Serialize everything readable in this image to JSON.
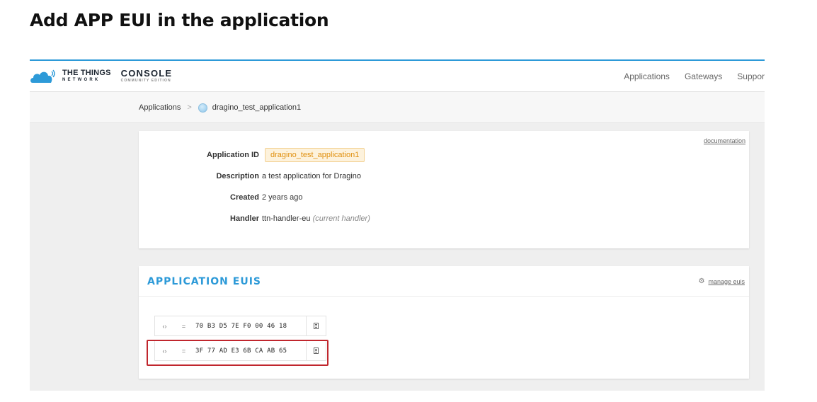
{
  "doc": {
    "title": "Add APP EUI in the application"
  },
  "navbar": {
    "logo_main": "THE THINGS",
    "logo_sub": "NETWORK",
    "console_main": "CONSOLE",
    "console_sub": "COMMUNITY EDITION",
    "links": [
      "Applications",
      "Gateways",
      "Suppor"
    ]
  },
  "breadcrumb": {
    "root": "Applications",
    "separator": ">",
    "current": "dragino_test_application1"
  },
  "info": {
    "documentation_link": "documentation",
    "rows": [
      {
        "label": "Application ID",
        "value": "dragino_test_application1"
      },
      {
        "label": "Description",
        "value": "a test application for Dragino"
      },
      {
        "label": "Created",
        "value": "2 years ago"
      },
      {
        "label": "Handler",
        "value": "ttn-handler-eu",
        "note": "(current handler)"
      }
    ]
  },
  "euis": {
    "title": "APPLICATION EUIS",
    "manage_label": "manage euis",
    "items": [
      {
        "value": "70 B3 D5 7E F0 00 46 18",
        "toggle_icon": "‹›",
        "format_icon": "="
      },
      {
        "value": "3F 77 AD E3 6B CA AB 65",
        "toggle_icon": "‹›",
        "format_icon": "="
      }
    ]
  },
  "colors": {
    "accent": "#2d9ad8",
    "badge_text": "#e0900f",
    "highlight": "#c0262d"
  }
}
